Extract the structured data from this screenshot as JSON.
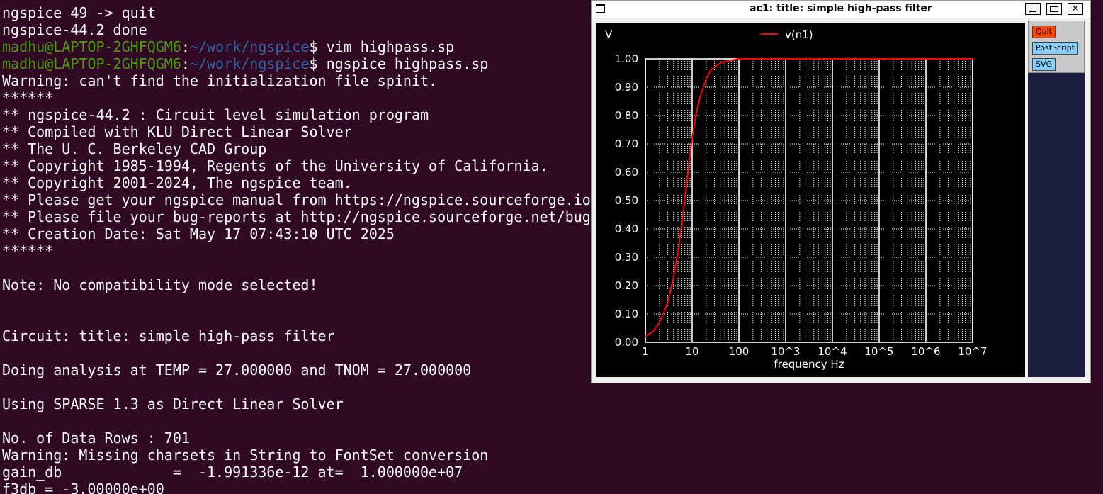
{
  "terminal": {
    "lines": [
      {
        "text": "ngspice 49 -> quit"
      },
      {
        "text": "ngspice-44.2 done"
      },
      {
        "user": "madhu@LAPTOP-2GHFQGM6",
        "colon": ":",
        "path": "~/work/ngspice",
        "cmd": "$ vim highpass.sp"
      },
      {
        "user": "madhu@LAPTOP-2GHFQGM6",
        "colon": ":",
        "path": "~/work/ngspice",
        "cmd": "$ ngspice highpass.sp"
      },
      {
        "text": "Warning: can't find the initialization file spinit."
      },
      {
        "text": "******"
      },
      {
        "text": "** ngspice-44.2 : Circuit level simulation program"
      },
      {
        "text": "** Compiled with KLU Direct Linear Solver"
      },
      {
        "text": "** The U. C. Berkeley CAD Group"
      },
      {
        "text": "** Copyright 1985-1994, Regents of the University of California."
      },
      {
        "text": "** Copyright 2001-2024, The ngspice team."
      },
      {
        "text": "** Please get your ngspice manual from https://ngspice.sourceforge.io"
      },
      {
        "text": "** Please file your bug-reports at http://ngspice.sourceforge.net/bug"
      },
      {
        "text": "** Creation Date: Sat May 17 07:43:10 UTC 2025"
      },
      {
        "text": "******"
      },
      {
        "text": ""
      },
      {
        "text": "Note: No compatibility mode selected!"
      },
      {
        "text": ""
      },
      {
        "text": ""
      },
      {
        "text": "Circuit: title: simple high-pass filter"
      },
      {
        "text": ""
      },
      {
        "text": "Doing analysis at TEMP = 27.000000 and TNOM = 27.000000"
      },
      {
        "text": ""
      },
      {
        "text": "Using SPARSE 1.3 as Direct Linear Solver"
      },
      {
        "text": ""
      },
      {
        "text": "No. of Data Rows : 701"
      },
      {
        "text": "Warning: Missing charsets in String to FontSet conversion"
      },
      {
        "text": "gain_db             =  -1.991336e-12 at=  1.000000e+07"
      },
      {
        "text": "f3db = -3.00000e+00"
      }
    ]
  },
  "window": {
    "title": "ac1: title: simple high-pass filter",
    "min_label": "",
    "max_label": "",
    "close_label": "✕",
    "icon": "window-icon"
  },
  "buttons": {
    "quit": "Quit",
    "postscript": "PostScript",
    "svg": "SVG"
  },
  "colors": {
    "terminal_bg": "#300a24",
    "prompt_user": "#4e9a06",
    "prompt_path": "#3465a4",
    "trace": "#ff0000",
    "plot_bg": "#000000",
    "quit_button": "#ff4500",
    "aux_buttons": "#87cefa"
  },
  "chart_data": {
    "type": "line",
    "title": "",
    "xlabel": "frequency   Hz",
    "ylabel": "V",
    "x_scale": "log",
    "xlim": [
      1,
      10000000
    ],
    "ylim": [
      0,
      1
    ],
    "grid": true,
    "legend": "top-left",
    "x_ticks": [
      {
        "value": 1,
        "label": "1"
      },
      {
        "value": 10,
        "label": "10"
      },
      {
        "value": 100,
        "label": "100"
      },
      {
        "value": 1000,
        "label": "10^3"
      },
      {
        "value": 10000,
        "label": "10^4"
      },
      {
        "value": 100000,
        "label": "10^5"
      },
      {
        "value": 1000000,
        "label": "10^6"
      },
      {
        "value": 10000000,
        "label": "10^7"
      }
    ],
    "y_ticks": [
      {
        "value": 0,
        "label": "0.00"
      },
      {
        "value": 0.1,
        "label": "0.10"
      },
      {
        "value": 0.2,
        "label": "0.20"
      },
      {
        "value": 0.3,
        "label": "0.30"
      },
      {
        "value": 0.4,
        "label": "0.40"
      },
      {
        "value": 0.5,
        "label": "0.50"
      },
      {
        "value": 0.6,
        "label": "0.60"
      },
      {
        "value": 0.7,
        "label": "0.70"
      },
      {
        "value": 0.8,
        "label": "0.80"
      },
      {
        "value": 0.9,
        "label": "0.90"
      },
      {
        "value": 1.0,
        "label": "1.00"
      }
    ],
    "series": [
      {
        "name": "v(n1)",
        "color": "#ff0000",
        "x": [
          1,
          1.5,
          2,
          3,
          4,
          5,
          6,
          7,
          8,
          9,
          10,
          12,
          15,
          20,
          25,
          30,
          40,
          50,
          70,
          100,
          1000,
          10000,
          100000,
          1000000,
          10000000
        ],
        "y": [
          0.02,
          0.04,
          0.07,
          0.14,
          0.23,
          0.32,
          0.42,
          0.51,
          0.59,
          0.66,
          0.72,
          0.8,
          0.87,
          0.93,
          0.96,
          0.97,
          0.985,
          0.99,
          0.995,
          1.0,
          1.0,
          1.0,
          1.0,
          1.0,
          1.0
        ]
      }
    ]
  }
}
